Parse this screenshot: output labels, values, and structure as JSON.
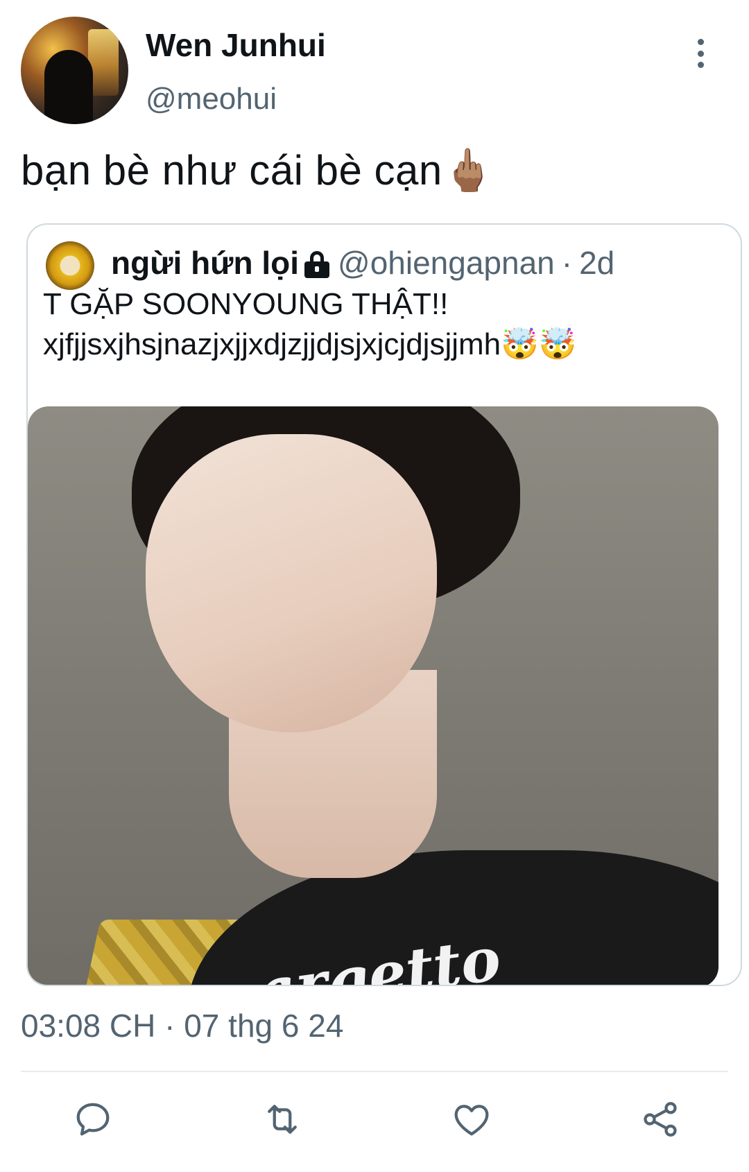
{
  "author": {
    "display_name": "Wen Junhui",
    "handle": "@meohui"
  },
  "tweet": {
    "text": "bạn bè như cái bè cạn🖕🏽",
    "timestamp": "03:08 CH · 07 thg 6 24"
  },
  "quoted": {
    "display_name": "ngừi hứn lọi",
    "handle": "@ohiengapnan",
    "separator": "·",
    "age": "2d",
    "line1": "T GẶP SOONYOUNG THẬT!!",
    "line2": "xjfjjsxjhsjnazjxjjxdjzjjdjsjxjcjdjsjjmh🤯🤯",
    "image_shirt_text": "argetto"
  },
  "icons": {
    "more": "more-vertical-icon",
    "lock": "lock-icon",
    "reply": "comment-icon",
    "retweet": "retweet-icon",
    "like": "heart-icon",
    "share": "share-icon"
  },
  "colors": {
    "text_primary": "#0f1419",
    "text_secondary": "#536471",
    "border": "#cfd9de"
  }
}
